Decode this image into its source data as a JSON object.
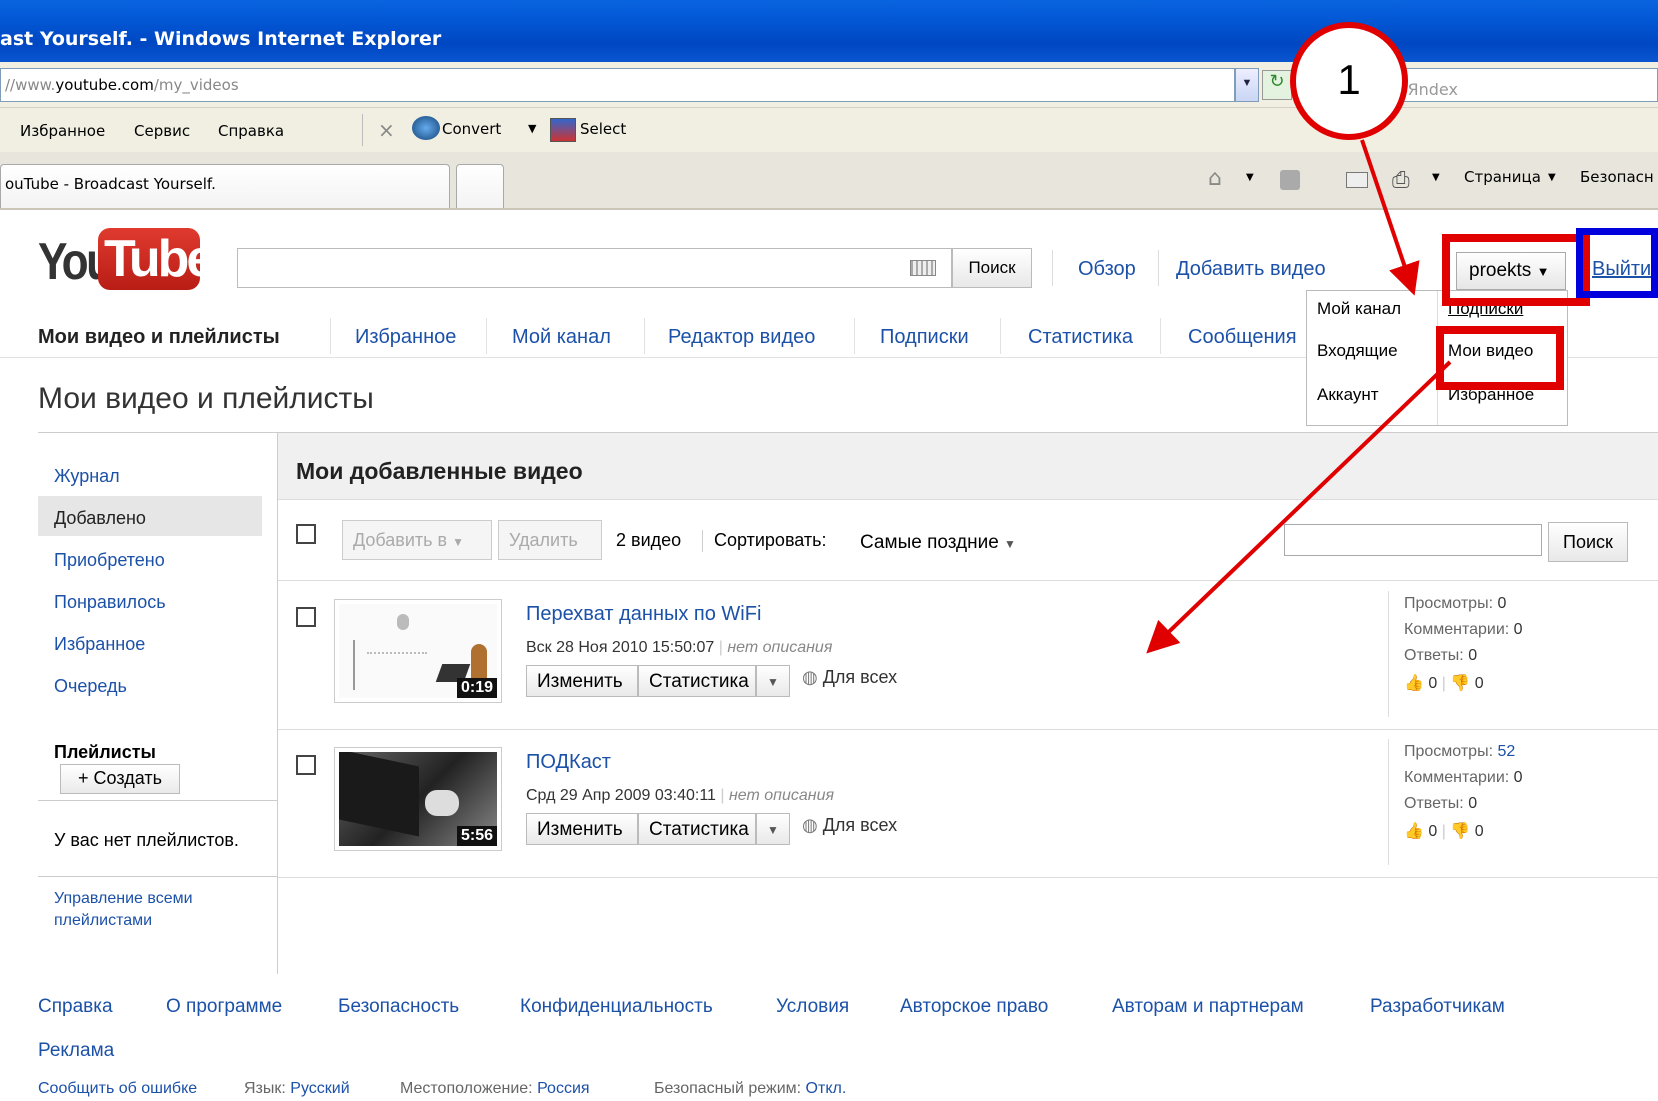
{
  "browser": {
    "title": "ast Yourself. - Windows Internet Explorer",
    "address_prefix": "//www.",
    "address_domain": "youtube.com",
    "address_path": "/my_videos",
    "yandex": "Яndex",
    "menu": [
      "Избранное",
      "Сервис",
      "Справка"
    ],
    "convert_label": "Convert",
    "select_label": "Select",
    "tab_title": "ouTube - Broadcast Yourself.",
    "page_menu": "Страница",
    "safety_menu": "Безопасн"
  },
  "header": {
    "logo_you": "You",
    "logo_tube": "Tube",
    "search_button": "Поиск",
    "browse": "Обзор",
    "upload": "Добавить видео",
    "username": "proekts",
    "logout": "Выйти"
  },
  "user_menu": {
    "my_channel": "Мой канал",
    "subscriptions": "Подписки",
    "inbox": "Входящие",
    "my_videos": "Мои видео",
    "account": "Аккаунт",
    "favorites": "Избранное"
  },
  "subnav": [
    "Мои видео и плейлисты",
    "Избранное",
    "Мой канал",
    "Редактор видео",
    "Подписки",
    "Статистика",
    "Сообщения"
  ],
  "page_title": "Мои видео и плейлисты",
  "sidebar": {
    "items": [
      "Журнал",
      "Добавлено",
      "Приобретено",
      "Понравилось",
      "Избранное",
      "Очередь"
    ],
    "playlists_heading": "Плейлисты",
    "create_button": "+ Создать",
    "no_playlists": "У вас нет плейлистов.",
    "manage_line1": "Управление всеми",
    "manage_line2": "плейлистами"
  },
  "main": {
    "heading": "Мои добавленные видео",
    "add_to": "Добавить в",
    "delete": "Удалить",
    "count": "2 видео",
    "sort_label": "Сортировать:",
    "sort_value": "Самые поздние",
    "search_button": "Поиск"
  },
  "videos": [
    {
      "title": "Перехват данных по WiFi",
      "date": "Вск 28 Ноя 2010 15:50:07",
      "desc": "нет описания",
      "duration": "0:19",
      "edit": "Изменить",
      "stats": "Статистика",
      "privacy": "Для всех",
      "views_label": "Просмотры:",
      "views": "0",
      "comments_label": "Комментарии:",
      "comments": "0",
      "replies_label": "Ответы:",
      "replies": "0",
      "likes": "0",
      "dislikes": "0"
    },
    {
      "title": "ПОДКаст",
      "date": "Срд 29 Апр 2009 03:40:11",
      "desc": "нет описания",
      "duration": "5:56",
      "edit": "Изменить",
      "stats": "Статистика",
      "privacy": "Для всех",
      "views_label": "Просмотры:",
      "views": "52",
      "comments_label": "Комментарии:",
      "comments": "0",
      "replies_label": "Ответы:",
      "replies": "0",
      "likes": "0",
      "dislikes": "0"
    }
  ],
  "footer": {
    "links": [
      "Справка",
      "О программе",
      "Безопасность",
      "Конфиденциальность",
      "Условия",
      "Авторское право",
      "Авторам и партнерам",
      "Разработчикам"
    ],
    "ads": "Реклама",
    "report": "Сообщить об ошибке",
    "lang_label": "Язык:",
    "lang_value": "Русский",
    "loc_label": "Местоположение:",
    "loc_value": "Россия",
    "safe_label": "Безопасный режим:",
    "safe_value": "Откл."
  },
  "annotation": {
    "marker": "1"
  },
  "colors": {
    "link": "#1c51a8",
    "highlight_red": "#e00000",
    "highlight_blue": "#0000dd",
    "ie_titlebar": "#0358d6"
  }
}
